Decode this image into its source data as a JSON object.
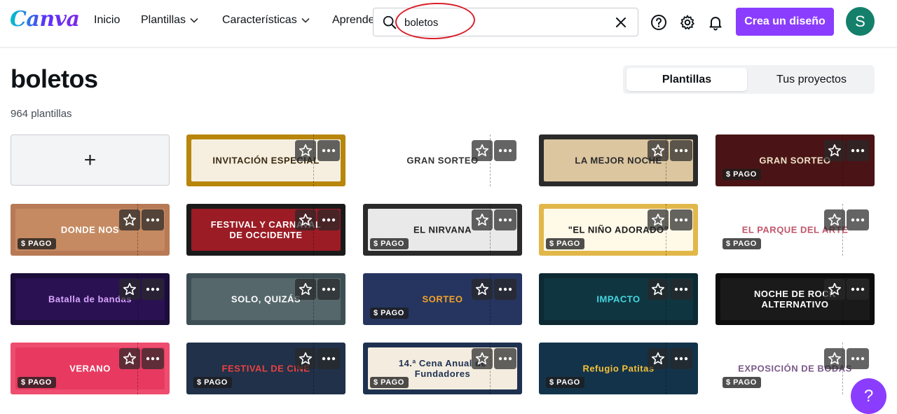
{
  "app": {
    "logo": "Canva"
  },
  "nav": {
    "inicio": "Inicio",
    "plantillas": "Plantillas",
    "caracteristicas": "Características",
    "aprende": "Aprende"
  },
  "search": {
    "value": "boletos"
  },
  "header": {
    "create_label": "Crea un diseño",
    "avatar_initial": "S",
    "help_icon": "help-circle-icon",
    "settings_icon": "gear-icon",
    "notifications_icon": "bell-icon"
  },
  "page": {
    "title": "boletos",
    "count": "964 plantillas",
    "tabs": [
      "Plantillas",
      "Tus proyectos"
    ]
  },
  "create_card": {
    "label": "+"
  },
  "badge_label": "$ PAGO",
  "help_fab": "?",
  "templates": [
    {
      "title": "INVITACIÓN ESPECIAL",
      "bg": "#b8860b",
      "fg": "#3a2a10",
      "inner": "#f6efe0",
      "paid": false
    },
    {
      "title": "GRAN SORTEO",
      "bg": "#ffffff",
      "fg": "#333333",
      "inner": "#ffffff",
      "paid": false
    },
    {
      "title": "LA MEJOR NOCHE",
      "bg": "#2b2b2b",
      "fg": "#2a2a2a",
      "inner": "#dcc6a0",
      "paid": false
    },
    {
      "title": "GRAN SORTEO",
      "bg": "#4a1416",
      "fg": "#efe2c8",
      "inner": "#4a1416",
      "paid": true
    },
    {
      "title": "DONDE NOS",
      "bg": "#b77a55",
      "fg": "#ffffff",
      "inner": "#c58a62",
      "paid": true
    },
    {
      "title": "FESTIVAL Y CARNAVAL DE OCCIDENTE",
      "bg": "#1a1a1a",
      "fg": "#ffffff",
      "inner": "#9b1c25",
      "paid": false
    },
    {
      "title": "EL NIRVANA",
      "bg": "#2b2b2b",
      "fg": "#222222",
      "inner": "#e9e9e9",
      "paid": true
    },
    {
      "title": "\"EL NIÑO ADORADO\"",
      "bg": "#e2b74a",
      "fg": "#1a1a1a",
      "inner": "#fff9e8",
      "paid": true
    },
    {
      "title": "EL PARQUE DEL ARTE",
      "bg": "#ffffff",
      "fg": "#c0566b",
      "inner": "#ffffff",
      "paid": true
    },
    {
      "title": "Batalla de bandas",
      "bg": "#1c0d3a",
      "fg": "#d9a5ff",
      "inner": "#2a1252",
      "paid": false
    },
    {
      "title": "SOLO, QUIZÁS",
      "bg": "#3d4f54",
      "fg": "#ffffff",
      "inner": "#55676b",
      "paid": false
    },
    {
      "title": "SORTEO",
      "bg": "#26355f",
      "fg": "#f2a32a",
      "inner": "#26355f",
      "paid": true
    },
    {
      "title": "IMPACTO",
      "bg": "#0d2a33",
      "fg": "#44d7e0",
      "inner": "#0f3540",
      "paid": false
    },
    {
      "title": "NOCHE DE ROCK ALTERNATIVO",
      "bg": "#0d0d0d",
      "fg": "#ffffff",
      "inner": "#1a1a1a",
      "paid": false
    },
    {
      "title": "VERANO",
      "bg": "#ee4d6f",
      "fg": "#ffffff",
      "inner": "#e83a60",
      "paid": true
    },
    {
      "title": "FESTIVAL DE CINE",
      "bg": "#203149",
      "fg": "#e8423f",
      "inner": "#203149",
      "paid": true
    },
    {
      "title": "14.ª Cena Anual de Fundadores",
      "bg": "#1e3150",
      "fg": "#1e3150",
      "inner": "#f3ecdf",
      "paid": true
    },
    {
      "title": "Refugio Patitas",
      "bg": "#13334a",
      "fg": "#f4c03a",
      "inner": "#13334a",
      "paid": true
    },
    {
      "title": "EXPOSICIÓN DE BODAS",
      "bg": "#ffffff",
      "fg": "#7a5a8a",
      "inner": "#ffffff",
      "paid": true
    }
  ]
}
